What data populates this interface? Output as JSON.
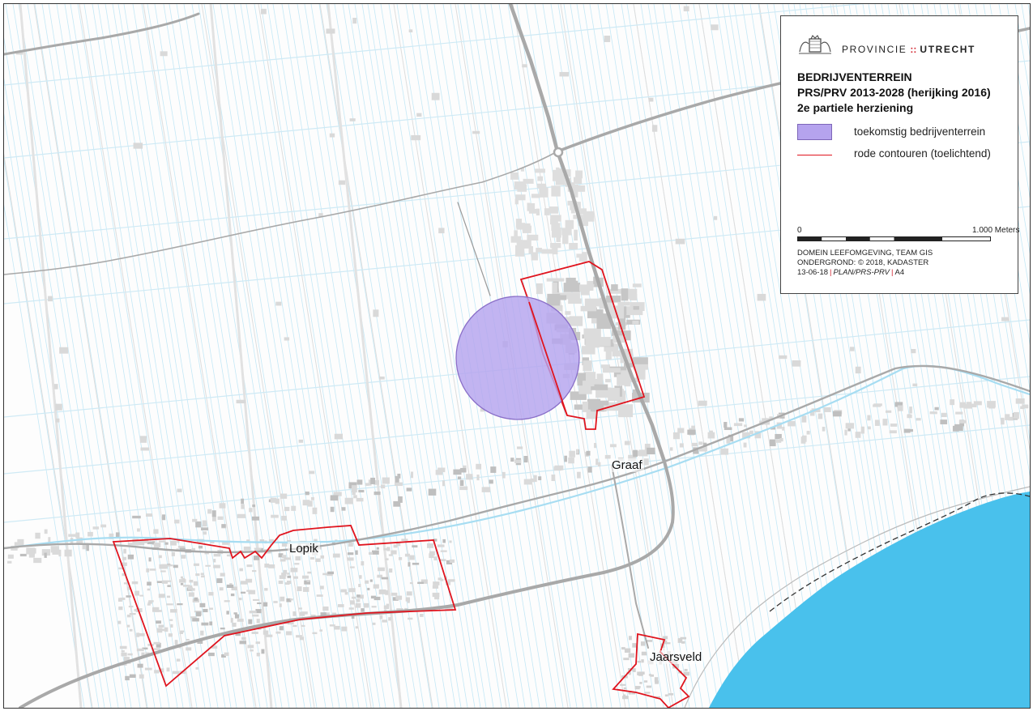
{
  "places": {
    "graaf": "Graaf",
    "lopik": "Lopik",
    "jaarsveld": "Jaarsveld"
  },
  "legend": {
    "logo": {
      "icon": "coat-of-arms-icon",
      "part1": "PROVINCIE",
      "separator": "::",
      "part2": "UTRECHT"
    },
    "title": [
      "BEDRIJVENTERREIN",
      "PRS/PRV 2013-2028 (herijking 2016)",
      "2e partiele herziening"
    ],
    "items": [
      {
        "label": "toekomstig bedrijventerrein",
        "symbol": "purple-fill",
        "color": "#b5a3ee"
      },
      {
        "label": "rode contouren (toelichtend)",
        "symbol": "red-line",
        "color": "#e0141e"
      }
    ],
    "scale": {
      "start": "0",
      "end": "1.000 Meters"
    },
    "footer": {
      "line1": "DOMEIN LEEFOMGEVING, TEAM GIS",
      "line2": "ONDERGROND: © 2018, KADASTER",
      "line3_date": "13-06-18",
      "line3_sep": "|",
      "line3_plan": "PLAN/PRS-PRV",
      "line3_size": "A4"
    }
  },
  "colors": {
    "water": "#a7ddf2",
    "river": "#49c1ec",
    "road": "#a9a9a9",
    "built": "#d6d6d6",
    "contour": "#e0141e",
    "future_zone": "#b5a3ee"
  }
}
